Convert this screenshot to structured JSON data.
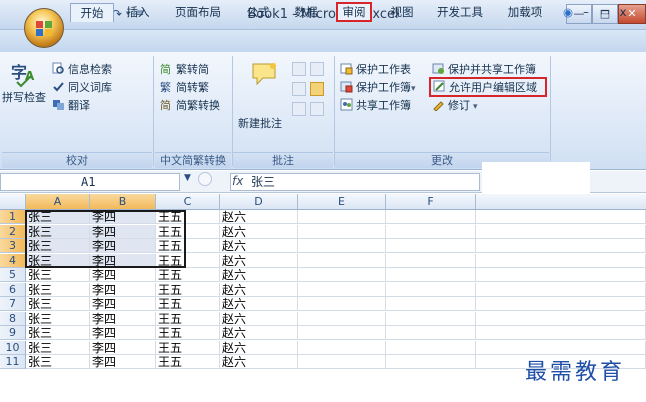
{
  "window": {
    "title": "Book1 - Microsoft Excel",
    "buttons": {
      "minimize": "—",
      "maximize": "□",
      "close": "✕"
    }
  },
  "quick_access": {
    "save_icon": "save-icon",
    "undo_icon": "undo-icon",
    "redo_icon": "redo-icon"
  },
  "tabs": [
    {
      "label": "开始"
    },
    {
      "label": "插入"
    },
    {
      "label": "页面布局"
    },
    {
      "label": "公式"
    },
    {
      "label": "数据"
    },
    {
      "label": "审阅"
    },
    {
      "label": "视图"
    },
    {
      "label": "开发工具"
    },
    {
      "label": "加载项"
    }
  ],
  "active_tab": "审阅",
  "ribbon": {
    "proofing": {
      "label": "校对",
      "spell_check": "拼写检查",
      "research": "信息检索",
      "thesaurus": "同义词库",
      "translate": "翻译"
    },
    "chinese_conversion": {
      "label": "中文简繁转换",
      "to_simplified": "繁转简",
      "to_traditional": "简转繁",
      "conversion": "简繁转换"
    },
    "comments": {
      "label": "批注",
      "new_comment": "新建批注"
    },
    "changes": {
      "label": "更改",
      "protect_sheet": "保护工作表",
      "protect_workbook": "保护工作簿",
      "share_workbook": "共享工作簿",
      "protect_and_share": "保护并共享工作簿",
      "allow_edit_ranges": "允许用户编辑区域",
      "track_changes": "修订"
    }
  },
  "formula_bar": {
    "name_box": "A1",
    "fx": "fx",
    "value": "张三"
  },
  "grid": {
    "columns": [
      "A",
      "B",
      "C",
      "D",
      "E",
      "F"
    ],
    "rows": [
      {
        "n": "1",
        "a": "张三",
        "b": "李四",
        "c": "王五",
        "d": "赵六"
      },
      {
        "n": "2",
        "a": "张三",
        "b": "李四",
        "c": "王五",
        "d": "赵六"
      },
      {
        "n": "3",
        "a": "张三",
        "b": "李四",
        "c": "王五",
        "d": "赵六"
      },
      {
        "n": "4",
        "a": "张三",
        "b": "李四",
        "c": "王五",
        "d": "赵六"
      },
      {
        "n": "5",
        "a": "张三",
        "b": "李四",
        "c": "王五",
        "d": "赵六"
      },
      {
        "n": "6",
        "a": "张三",
        "b": "李四",
        "c": "王五",
        "d": "赵六"
      },
      {
        "n": "7",
        "a": "张三",
        "b": "李四",
        "c": "王五",
        "d": "赵六"
      },
      {
        "n": "8",
        "a": "张三",
        "b": "李四",
        "c": "王五",
        "d": "赵六"
      },
      {
        "n": "9",
        "a": "张三",
        "b": "李四",
        "c": "王五",
        "d": "赵六"
      },
      {
        "n": "10",
        "a": "张三",
        "b": "李四",
        "c": "王五",
        "d": "赵六"
      },
      {
        "n": "11",
        "a": "张三",
        "b": "李四",
        "c": "王五",
        "d": "赵六"
      }
    ],
    "selection": "A1:B4"
  },
  "watermark": "最需教育",
  "colors": {
    "highlight": "#d6262a",
    "ribbon": "#dbe7f6",
    "watermark": "#1f4fa8"
  }
}
